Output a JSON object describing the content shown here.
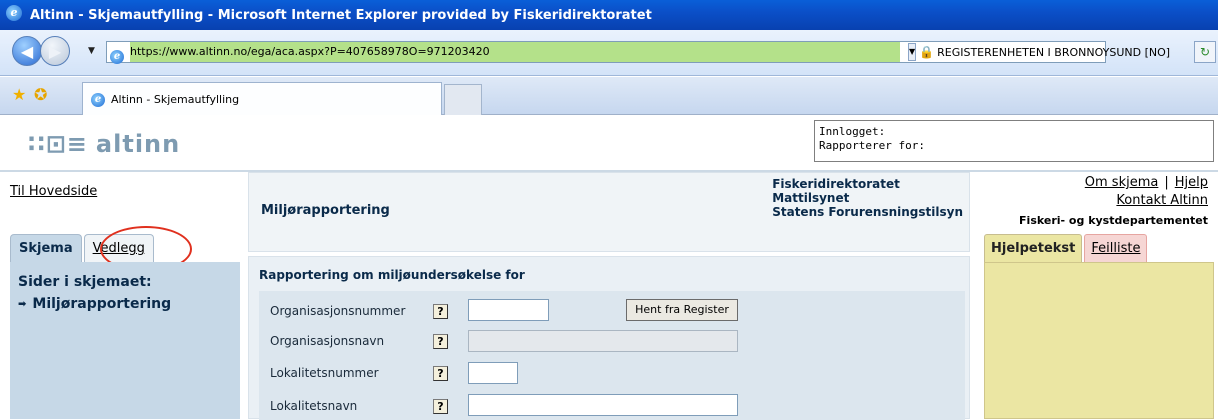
{
  "window": {
    "title": "Altinn - Skjemautfylling - Microsoft Internet Explorer provided by Fiskeridirektoratet"
  },
  "addressbar": {
    "url": "https://www.altinn.no/ega/aca.aspx?P=407658978O=971203420",
    "certificate": "REGISTERENHETEN I BRONNOYSUND [NO]"
  },
  "tabbar": {
    "tab_title": "Altinn - Skjemautfylling"
  },
  "header": {
    "logo_text": "altinn",
    "logo_mark": "∷⊡≡",
    "login_line1": "Innlogget:",
    "login_line2": "Rapporterer for:"
  },
  "nav": {
    "home_link": "Til Hovedside",
    "tabs": [
      {
        "label": "Skjema"
      },
      {
        "label": "Vedlegg"
      }
    ],
    "pages_header": "Sider i skjemaet:",
    "pages": [
      {
        "label": "Miljørapportering"
      }
    ]
  },
  "form": {
    "title": "Miljørapportering",
    "organizations": [
      "Fiskeridirektoratet",
      "Mattilsynet",
      "Statens Forurensningstilsyn"
    ],
    "section_title": "Rapportering om miljøundersøkelse for",
    "fields": [
      {
        "label": "Organisasjonsnummer",
        "value": ""
      },
      {
        "label": "Organisasjonsnavn",
        "value": ""
      },
      {
        "label": "Lokalitetsnummer",
        "value": ""
      },
      {
        "label": "Lokalitetsnavn",
        "value": ""
      }
    ],
    "help_label": "?",
    "register_button": "Hent fra Register"
  },
  "right": {
    "om_skjema": "Om skjema",
    "separator": "|",
    "hjelp": "Hjelp",
    "kontakt": "Kontakt Altinn",
    "department": "Fiskeri- og kystdepartementet",
    "tabs": [
      {
        "label": "Hjelpetekst"
      },
      {
        "label": "Feilliste"
      }
    ]
  }
}
